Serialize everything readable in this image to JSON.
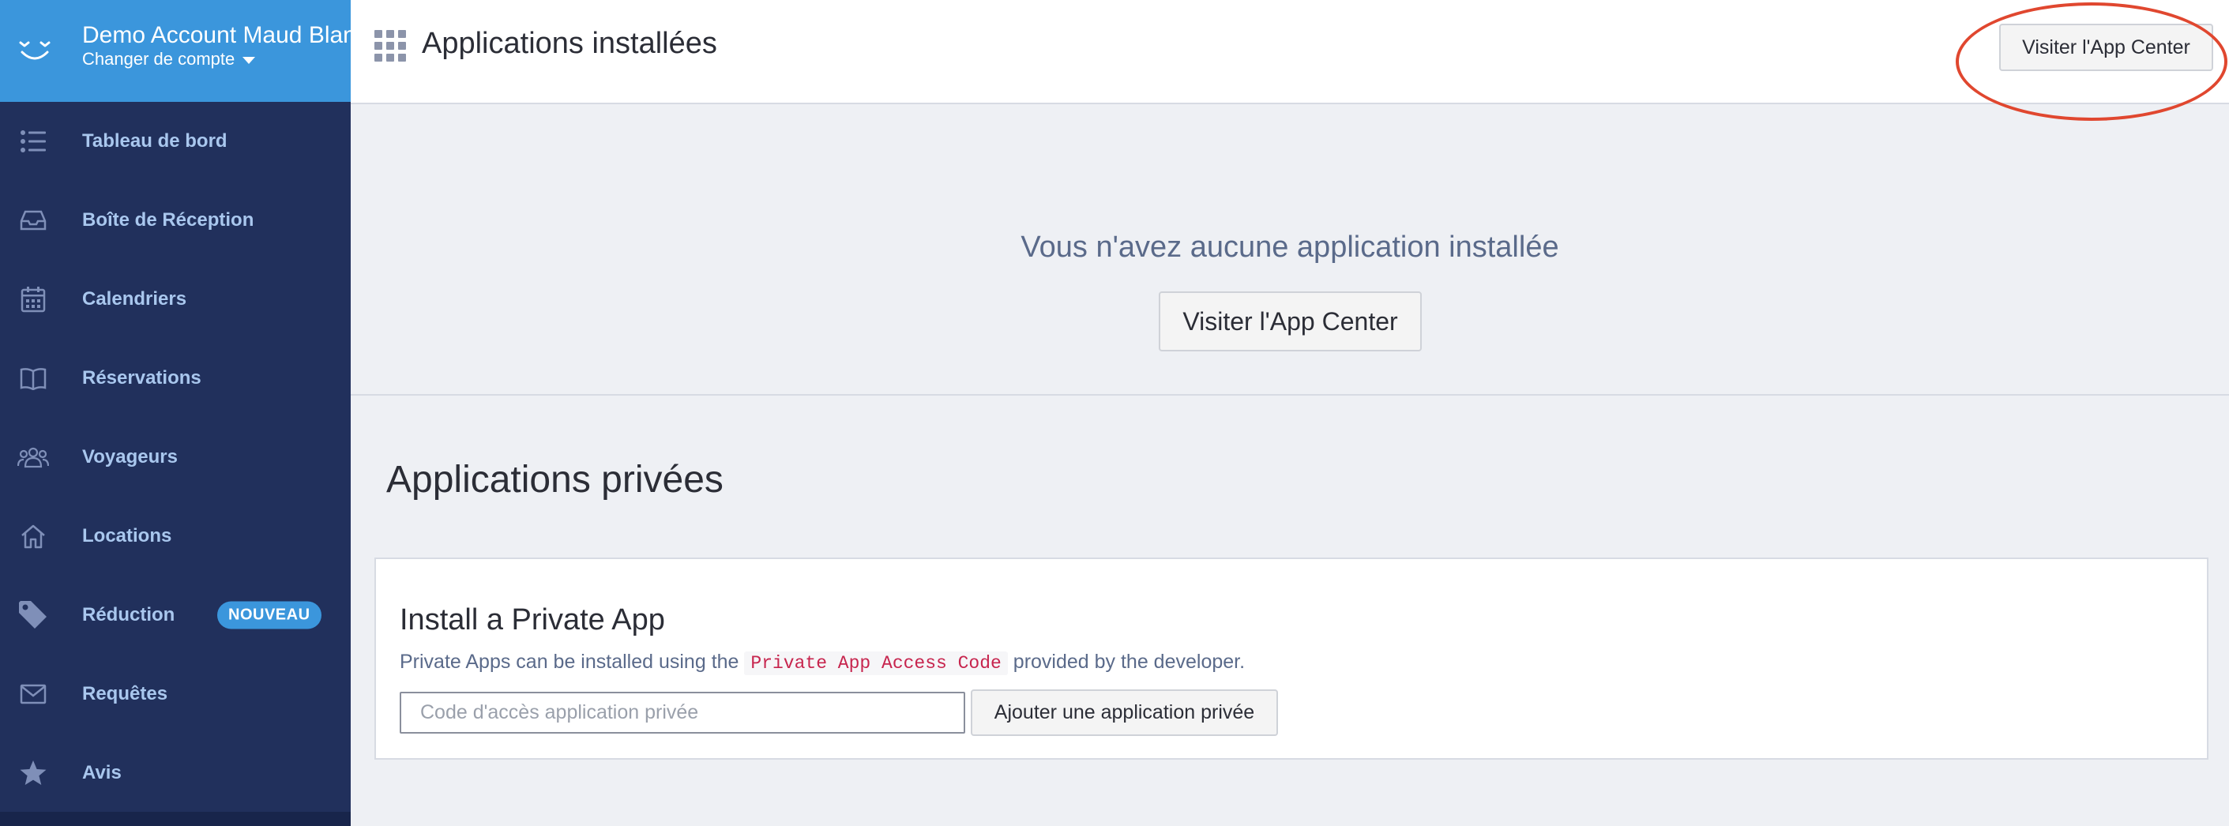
{
  "account": {
    "name": "Demo Account Maud Blan",
    "switch_label": "Changer de compte",
    "logo_icon": "smile-logo-icon"
  },
  "sidebar": {
    "items": [
      {
        "label": "Tableau de bord",
        "icon": "list-icon"
      },
      {
        "label": "Boîte de Réception",
        "icon": "inbox-icon"
      },
      {
        "label": "Calendriers",
        "icon": "calendar-icon"
      },
      {
        "label": "Réservations",
        "icon": "book-icon"
      },
      {
        "label": "Voyageurs",
        "icon": "users-icon"
      },
      {
        "label": "Locations",
        "icon": "home-icon"
      },
      {
        "label": "Réduction",
        "icon": "tag-icon",
        "badge": "NOUVEAU"
      },
      {
        "label": "Requêtes",
        "icon": "envelope-icon"
      },
      {
        "label": "Avis",
        "icon": "star-icon"
      }
    ]
  },
  "header": {
    "title": "Applications installées",
    "visit_button": "Visiter l'App Center"
  },
  "empty_state": {
    "message": "Vous n'avez aucune application installée",
    "button": "Visiter l'App Center"
  },
  "private_apps": {
    "title": "Applications privées",
    "card_title": "Install a Private App",
    "desc_before": "Private Apps can be installed using the ",
    "desc_code": "Private App Access Code",
    "desc_after": " provided by the developer.",
    "input_placeholder": "Code d'accès application privée",
    "add_button": "Ajouter une application privée"
  },
  "colors": {
    "sidebar_bg": "#21305c",
    "account_bg": "#3b96dc",
    "nav_text": "#a9c7ee",
    "annotation": "#e0472f"
  }
}
